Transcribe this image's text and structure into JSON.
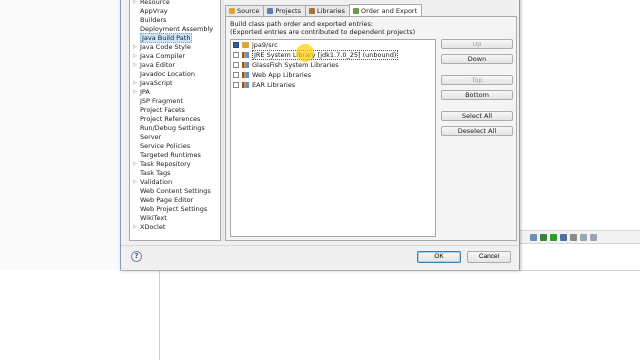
{
  "tree": {
    "items": [
      {
        "label": "Resource",
        "arrow": "▷"
      },
      {
        "label": "AppVray",
        "arrow": ""
      },
      {
        "label": "Builders",
        "arrow": ""
      },
      {
        "label": "Deployment Assembly",
        "arrow": ""
      },
      {
        "label": "Java Build Path",
        "arrow": "",
        "selected": true
      },
      {
        "label": "Java Code Style",
        "arrow": "▷"
      },
      {
        "label": "Java Compiler",
        "arrow": "▷"
      },
      {
        "label": "Java Editor",
        "arrow": "▷"
      },
      {
        "label": "Javadoc Location",
        "arrow": ""
      },
      {
        "label": "JavaScript",
        "arrow": "▷"
      },
      {
        "label": "JPA",
        "arrow": "▷"
      },
      {
        "label": "JSP Fragment",
        "arrow": ""
      },
      {
        "label": "Project Facets",
        "arrow": ""
      },
      {
        "label": "Project References",
        "arrow": ""
      },
      {
        "label": "Run/Debug Settings",
        "arrow": ""
      },
      {
        "label": "Server",
        "arrow": ""
      },
      {
        "label": "Service Policies",
        "arrow": ""
      },
      {
        "label": "Targeted Runtimes",
        "arrow": ""
      },
      {
        "label": "Task Repository",
        "arrow": "▷"
      },
      {
        "label": "Task Tags",
        "arrow": ""
      },
      {
        "label": "Validation",
        "arrow": "▷"
      },
      {
        "label": "Web Content Settings",
        "arrow": ""
      },
      {
        "label": "Web Page Editor",
        "arrow": ""
      },
      {
        "label": "Web Project Settings",
        "arrow": ""
      },
      {
        "label": "WikiText",
        "arrow": ""
      },
      {
        "label": "XDoclet",
        "arrow": "▷"
      }
    ]
  },
  "tabs": [
    {
      "label": "Source",
      "icon": "source-folder-icon",
      "color": "#d9a53a"
    },
    {
      "label": "Projects",
      "icon": "projects-icon",
      "color": "#5b7fb4"
    },
    {
      "label": "Libraries",
      "icon": "libraries-icon",
      "color": "#a5743e"
    },
    {
      "label": "Order and Export",
      "icon": "order-export-icon",
      "color": "#6a9a4a",
      "active": true
    }
  ],
  "info": {
    "line1": "Build class path order and exported entries:",
    "line2": "(Exported entries are contributed to dependent projects)"
  },
  "entries": [
    {
      "label": "jpa9/src",
      "icon": "source-folder-icon",
      "checked": true,
      "selected": false
    },
    {
      "label": "JRE System Library [jdk1.7.0_25] (unbound)",
      "icon": "library-icon",
      "checked": false,
      "selected": true
    },
    {
      "label": "GlassFish System Libraries",
      "icon": "library-icon",
      "checked": false,
      "selected": false
    },
    {
      "label": "Web App Libraries",
      "icon": "library-icon",
      "checked": false,
      "selected": false
    },
    {
      "label": "EAR Libraries",
      "icon": "library-icon",
      "checked": false,
      "selected": false
    }
  ],
  "buttons": {
    "up": "Up",
    "down": "Down",
    "top": "Top",
    "bottom": "Bottom",
    "select_all": "Select All",
    "deselect_all": "Deselect All"
  },
  "footer": {
    "help": "?",
    "ok": "OK",
    "cancel": "Cancel"
  },
  "toolbar_icons": [
    {
      "name": "console-icon",
      "color": "#6a8fb8"
    },
    {
      "name": "debug-icon",
      "color": "#3f7f3f"
    },
    {
      "name": "run-icon",
      "color": "#2aa02a"
    },
    {
      "name": "profile-icon",
      "color": "#5070a0"
    },
    {
      "name": "stop-icon",
      "color": "#8a8a8a"
    },
    {
      "name": "minimize-icon",
      "color": "#9aa6b6"
    },
    {
      "name": "maximize-icon",
      "color": "#9aa6b6"
    }
  ],
  "colors": {
    "dialog_bg": "#f0f0f0",
    "selection_bg": "#cde4f7",
    "cursor_highlight": "#ffcd00"
  }
}
